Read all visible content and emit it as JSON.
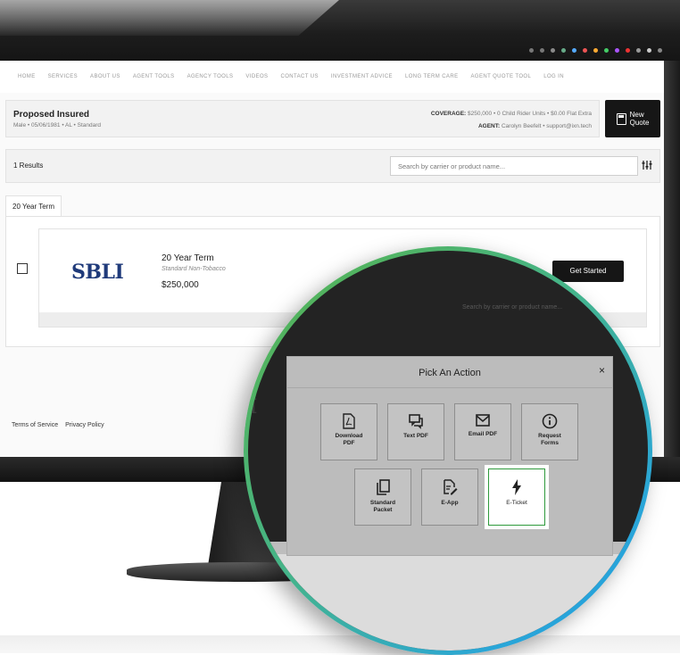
{
  "nav": {
    "items": [
      "HOME",
      "SERVICES",
      "ABOUT US",
      "AGENT TOOLS",
      "AGENCY TOOLS",
      "VIDEOS",
      "CONTACT US",
      "INVESTMENT ADVICE",
      "LONG TERM CARE",
      "AGENT QUOTE TOOL",
      "LOG IN"
    ]
  },
  "insured": {
    "title": "Proposed Insured",
    "details": "Male • 05/06/1981 • AL • Standard",
    "coverage_label": "COVERAGE:",
    "coverage_value": "$250,000 • 0 Child Rider Units • $0.00 Flat Extra",
    "agent_label": "AGENT:",
    "agent_value": "Carolyn Beefelt • support@ixn.tech"
  },
  "new_quote": {
    "label_line1": "New",
    "label_line2": "Quote"
  },
  "results": {
    "count": "1 Results",
    "search_placeholder": "Search by carrier or product name...",
    "filter_icon": "sliders-icon"
  },
  "tabs": [
    {
      "label": "20 Year Term"
    }
  ],
  "product": {
    "carrier_logo": "SBLI",
    "name": "20 Year Term",
    "rate_class": "Standard Non-Tobacco",
    "amount": "$250,000",
    "cta": "Get Started"
  },
  "footer": {
    "terms": "Terms of Service",
    "privacy": "Privacy Policy"
  },
  "magnified_ghost": "Search by carrier or product name...",
  "modal": {
    "title": "Pick An Action",
    "close": "×",
    "actions": [
      {
        "icon": "pdf-file-icon",
        "label_line1": "Download",
        "label_line2": "PDF"
      },
      {
        "icon": "chat-icon",
        "label_line1": "Text PDF",
        "label_line2": ""
      },
      {
        "icon": "envelope-icon",
        "label_line1": "Email PDF",
        "label_line2": ""
      },
      {
        "icon": "info-icon",
        "label_line1": "Request",
        "label_line2": "Forms"
      },
      {
        "icon": "copy-documents-icon",
        "label_line1": "Standard",
        "label_line2": "Packet"
      },
      {
        "icon": "document-edit-icon",
        "label_line1": "E-App",
        "label_line2": ""
      },
      {
        "icon": "lightning-icon",
        "label_line1": "E-Ticket",
        "label_line2": ""
      }
    ],
    "selected": "E-Ticket"
  },
  "colors": {
    "accent_dark": "#161616",
    "selected_border": "#2e9a3c",
    "ring_green": "#58b24a",
    "ring_blue": "#1f9bde",
    "logo_blue": "#1f3a7a"
  }
}
